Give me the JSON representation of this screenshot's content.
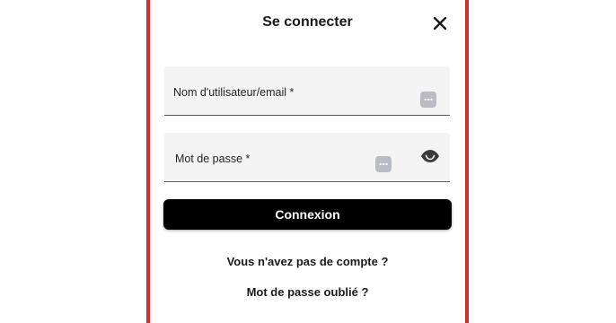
{
  "dialog": {
    "title": "Se connecter",
    "close_icon": "close-icon"
  },
  "form": {
    "username_label": "Nom d'utilisateur/email *",
    "password_label": "Mot de passe *",
    "autofill_icon": "password-manager-icon",
    "visibility_icon": "eye-icon",
    "submit_label": "Connexion"
  },
  "links": {
    "signup": "Vous n'avez pas de compte ?",
    "forgot": "Mot de passe oublié ?"
  },
  "colors": {
    "frame_border": "#d42f2f",
    "button_bg": "#000000",
    "field_bg": "#f4f4f5"
  }
}
